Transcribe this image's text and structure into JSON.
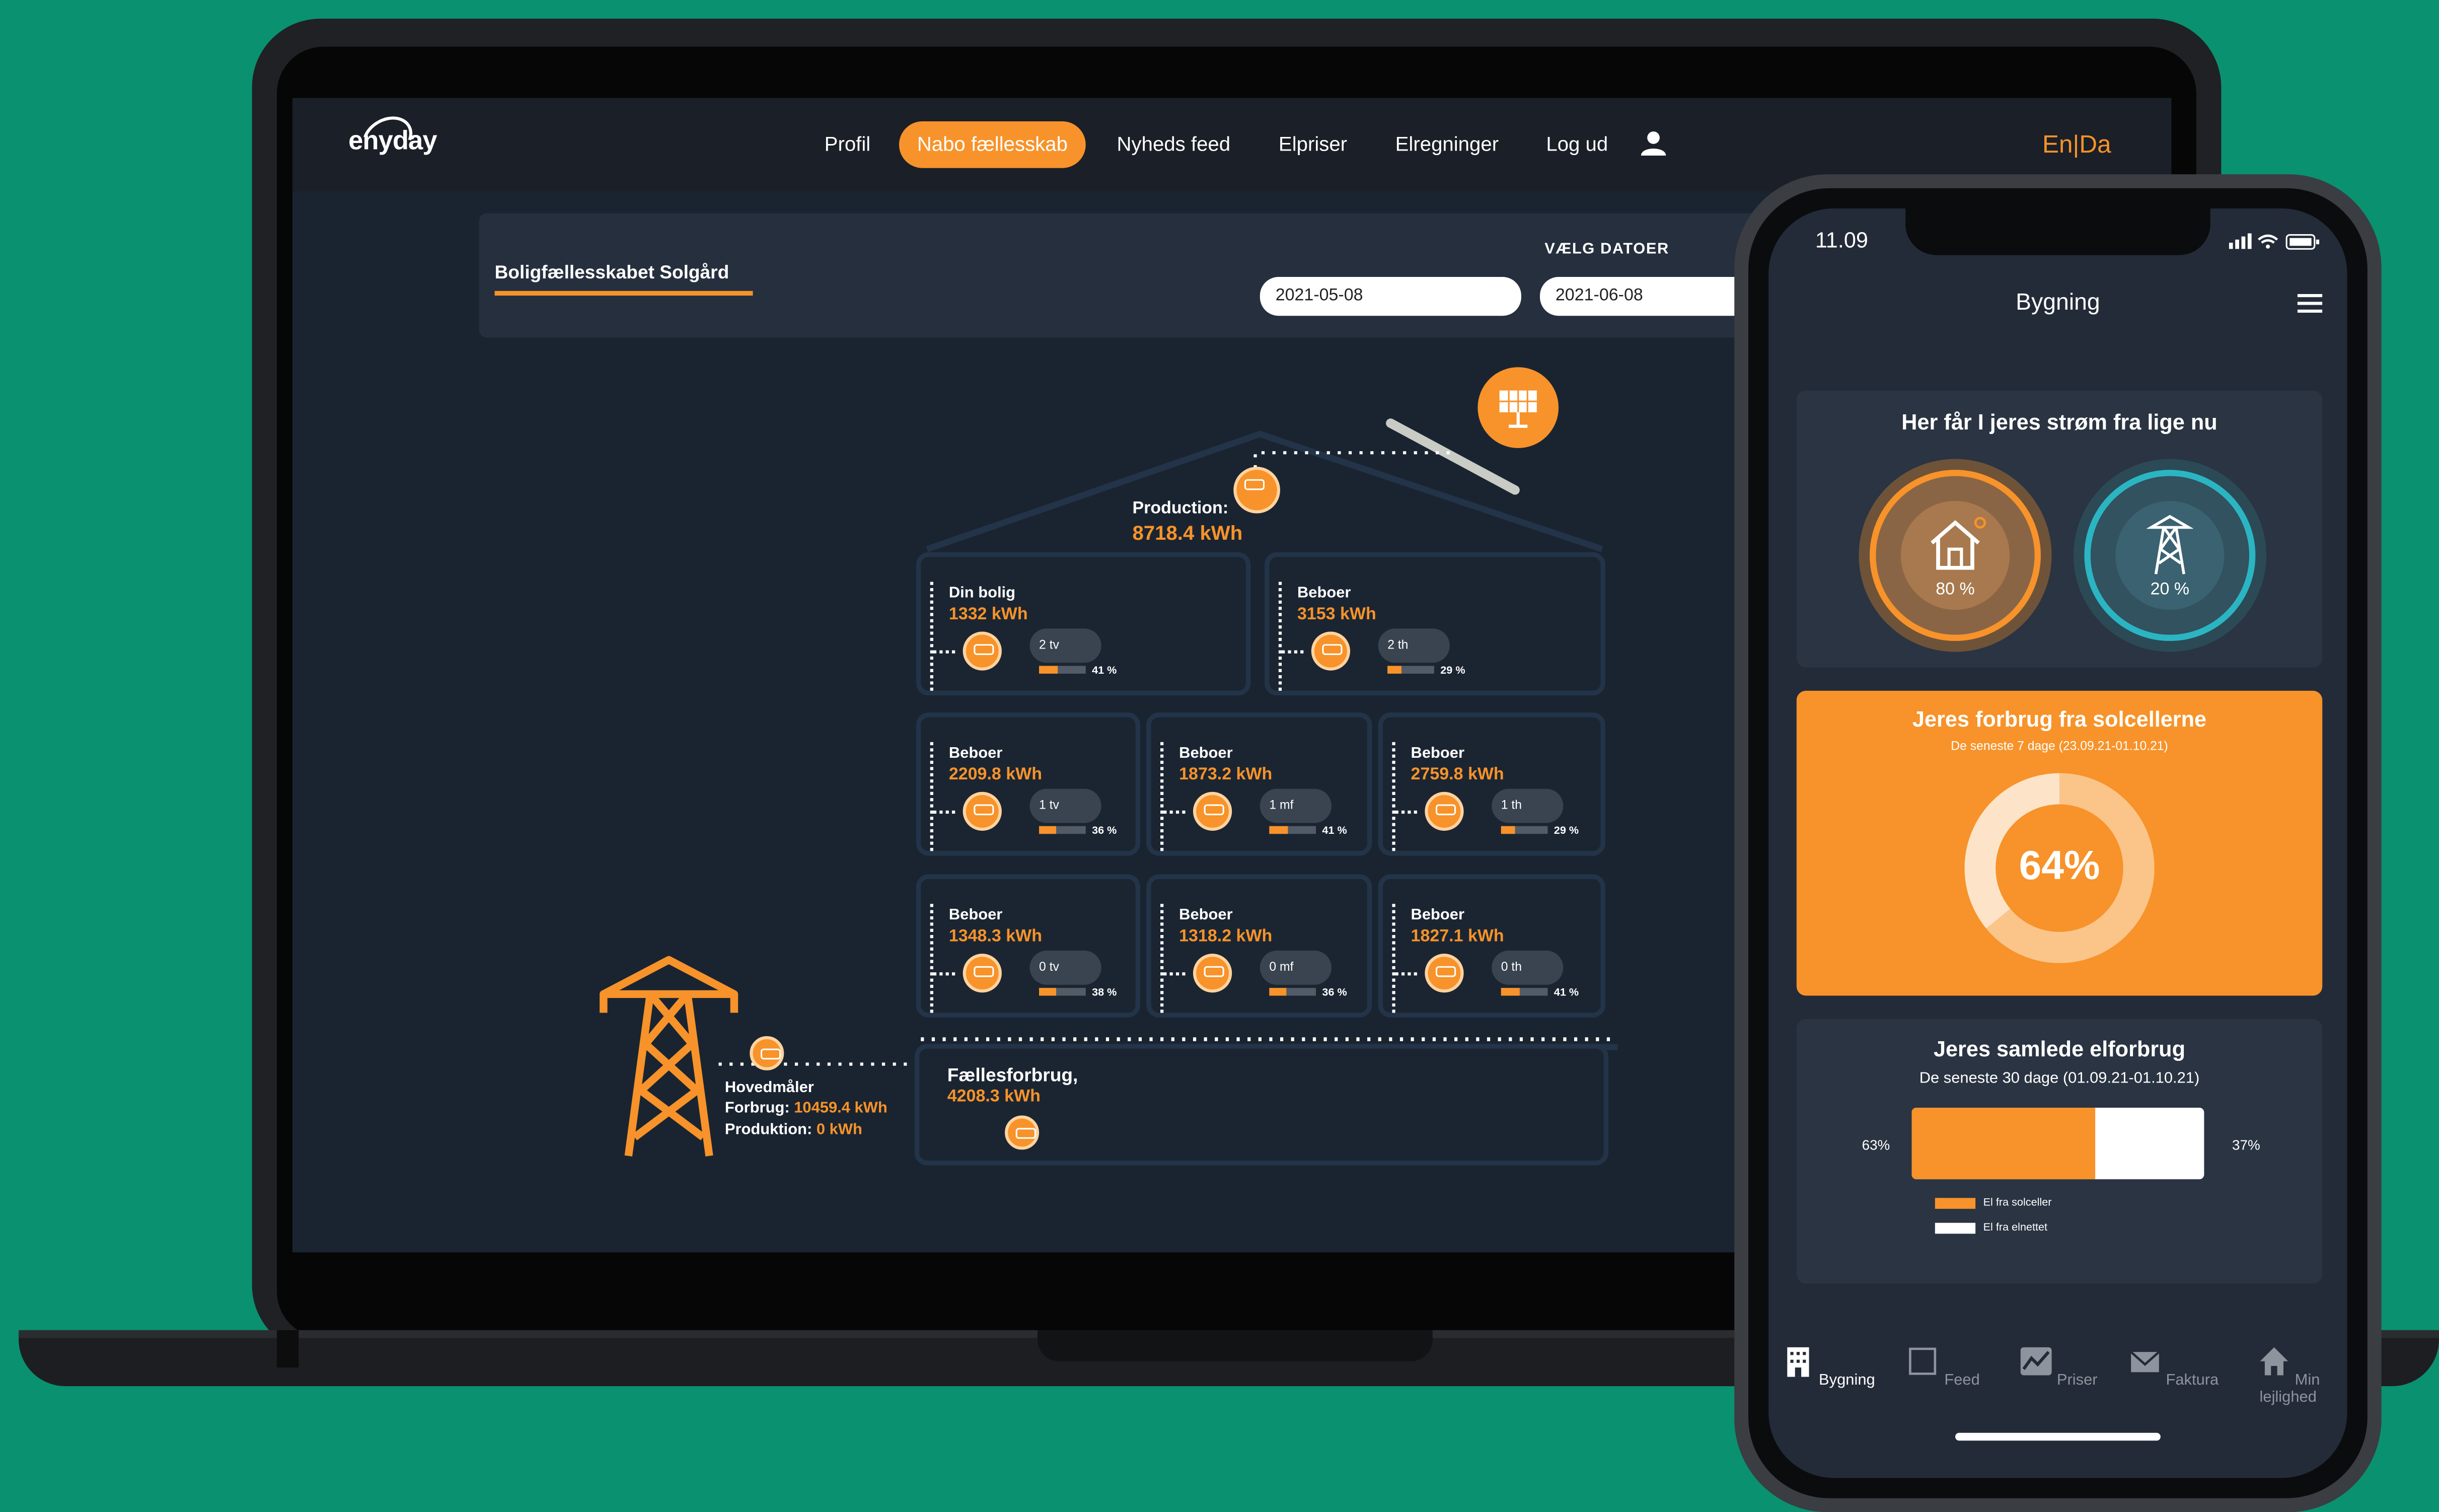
{
  "nav": {
    "logo": "enyday",
    "items": [
      "Profil",
      "Nabo fællesskab",
      "Nyheds feed",
      "Elpriser",
      "Elregninger",
      "Log ud"
    ],
    "lang_en": "En",
    "lang_sep": "|",
    "lang_da": "Da"
  },
  "header": {
    "title": "Boligfællesskabet Solgård",
    "date_label": "VÆLG DATOER",
    "date_from": "2021-05-08",
    "date_to": "2021-06-08"
  },
  "building": {
    "production_label": "Production:",
    "production_value": "8718.4 kWh",
    "units": [
      {
        "title": "Din bolig",
        "kwh": "1332 kWh",
        "apt": "2 tv",
        "pct": "41 %",
        "fill": 0.41
      },
      {
        "title": "Beboer",
        "kwh": "3153 kWh",
        "apt": "2 th",
        "pct": "29 %",
        "fill": 0.29
      },
      {
        "title": "Beboer",
        "kwh": "2209.8 kWh",
        "apt": "1 tv",
        "pct": "36 %",
        "fill": 0.36
      },
      {
        "title": "Beboer",
        "kwh": "1873.2 kWh",
        "apt": "1 mf",
        "pct": "41 %",
        "fill": 0.41
      },
      {
        "title": "Beboer",
        "kwh": "2759.8 kWh",
        "apt": "1 th",
        "pct": "29 %",
        "fill": 0.29
      },
      {
        "title": "Beboer",
        "kwh": "1348.3 kWh",
        "apt": "0 tv",
        "pct": "38 %",
        "fill": 0.38
      },
      {
        "title": "Beboer",
        "kwh": "1318.2 kWh",
        "apt": "0 mf",
        "pct": "36 %",
        "fill": 0.36
      },
      {
        "title": "Beboer",
        "kwh": "1827.1 kWh",
        "apt": "0 th",
        "pct": "41 %",
        "fill": 0.41
      }
    ],
    "common_label": "Fællesforbrug,",
    "common_value": "4208.3 kWh",
    "main_meter_label": "Hovedmåler",
    "consumption_label": "Forbrug:",
    "consumption_value": "10459.4 kWh",
    "production2_label": "Produktion:",
    "production2_value": "0 kWh"
  },
  "phone": {
    "time": "11.09",
    "title": "Bygning",
    "source_card": {
      "title": "Her får I jeres strøm fra lige nu",
      "solar_pct": "80 %",
      "grid_pct": "20 %"
    },
    "solar_card": {
      "title": "Jeres forbrug fra solcellerne",
      "subtitle": "De seneste 7 dage (23.09.21-01.10.21)",
      "value": "64%",
      "fraction": 0.64
    },
    "total_card": {
      "title": "Jeres samlede elforbrug",
      "subtitle": "De seneste 30 dage (01.09.21-01.10.21)",
      "left_pct": "63%",
      "right_pct": "37%",
      "solar_fraction": 0.63,
      "legend_solar": "El fra solceller",
      "legend_grid": "El fra elnettet"
    },
    "tabs": [
      "Bygning",
      "Feed",
      "Priser",
      "Faktura",
      "Min lejlighed"
    ]
  },
  "colors": {
    "background": "#0a9170",
    "accent": "#f7932a",
    "teal": "#2bb5c3",
    "screen_bg": "#1a2431"
  }
}
